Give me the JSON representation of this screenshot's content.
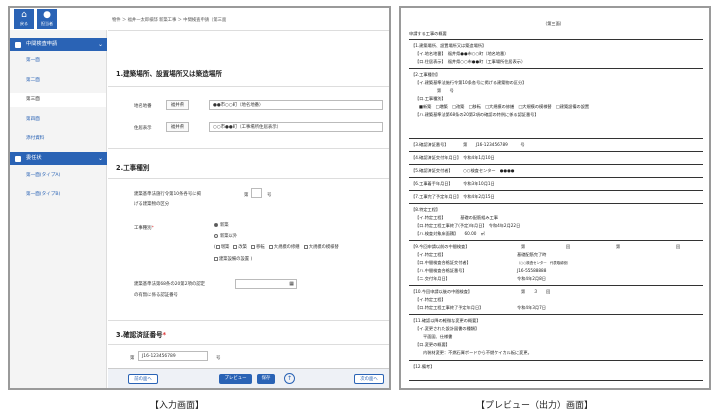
{
  "left_panel": {
    "top_icons": {
      "home_label": "戻る",
      "user_label": "担当者"
    },
    "sidebar": {
      "section1": "中間検査申請",
      "items1": [
        "第一面",
        "第二面",
        "第三面",
        "第四面",
        "添付資料"
      ],
      "section2": "委任状",
      "items2": [
        "第一面(タイプA)",
        "第一面(タイプB)"
      ]
    },
    "breadcrumb": "物件 ＞ 福井一太郎様邸 新築工事 ＞ 中間検査申請（第三面",
    "section1": {
      "title": "1.建築場所、設置場所又は築造場所",
      "location_label": "地名地番",
      "location_pref": "福井県",
      "location_value": "●●市○○町（地名地番）",
      "address_label": "住居表示",
      "address_pref": "福井県",
      "address_value": "○○市●●町（工事場所住居表示）"
    },
    "section2": {
      "title": "2.工事種別",
      "article_label_1": "建築基準法施行令第10条各号に掲",
      "article_label_2": "げる建築物の区分",
      "article_prefix": "第",
      "article_suffix": "号",
      "type_label": "工事種別",
      "radio_new": "新築",
      "radio_other": "新築以外",
      "checks": [
        "増築",
        "改築",
        "移転",
        "大規模の修繕",
        "大規模の模様替"
      ],
      "check_extra": "建築設備の設置",
      "law_label_1": "建築基準法第68条の20第2項の認定",
      "law_label_2": "の有無に係る認証番号",
      "law_icon": "calendar-icon"
    },
    "section3": {
      "title": "3.確認済証番号",
      "prefix": "第",
      "value": "J16-123456789",
      "suffix": "号",
      "next_title_partial": "4.確認済証交付年月日"
    },
    "footer": {
      "prev": "前の面へ",
      "preview": "プレビュー",
      "save": "保存",
      "next": "次の面へ"
    }
  },
  "right_panel": {
    "page_title": "（第三面）",
    "heading": "申請する工事の概要",
    "lines": [
      "【1.建築場所、設置場所又は築造場所】",
      "【イ.地名地番】　福井県●●市○○町（地名地番）",
      "【ロ.住居表示】　福井県○○市●●町（工事場所住居表示）",
      "【2.工事種別】",
      "【イ.建築基準法施行令第10条各号に掲げる建築物の区分】",
      "第　　号",
      "【ロ.工事種別】",
      "■新築　□増築　□改築　□移転　□大規模の修繕　□大規模の模様替　□建築設備の設置",
      "【ハ.建築基準法第68条の20第2項の確認の特例に係る認証番号】",
      "【3.確認済証番号】　　　　第　　J16-123456789　　　号",
      "【4.確認済証交付年月日】　令和4年1月10日",
      "【5.確認済証交付者】　　　○○検査センター　●●●●",
      "【6.工事着手年月日】　　　令和3年10月1日",
      "【7.工事完了予定年月日】　令和4年2月15日",
      "【8.特定工程】",
      "【イ.特定工程】　　　　基礎の配筋組み工事",
      "【ロ.特定工程工事終了(予定)年月日】　令和4年2月22日",
      "【ハ.検査対象床面積】　　60.00　㎡",
      "【9.今回申請以前の中間検査】",
      "【イ.特定工程】",
      "【ロ.中間検査合格証交付者】",
      "【ハ.中間検査合格証番号】",
      "【ニ.交付年月日】",
      "【10.今回申請以後の中間検査】",
      "【イ.特定工程】",
      "【ロ.特定工程工事終了予定年月日】",
      "【11.確認以降の軽微な変更の概要】",
      "【イ.変更された設計図書の種類】",
      "平面図、仕様書",
      "【ロ.変更の概要】",
      "内装材変更：不燃石膏ボードから不燃ケイカル板に変更。",
      "【12.備考】"
    ],
    "prev_fields": {
      "col1": "第",
      "col2": "回",
      "col3": "第",
      "col4": "回",
      "p1": "基礎配筋完了時",
      "p2": "（○○検査センター　代表取締役）",
      "p3": "J16-55588888",
      "p4": "令和4年2月8日",
      "n1": "第　　３　　回",
      "n3": "令和4年3月7日"
    }
  },
  "captions": {
    "left": "【入力画面】",
    "right": "【プレビュー（出力）画面】"
  }
}
